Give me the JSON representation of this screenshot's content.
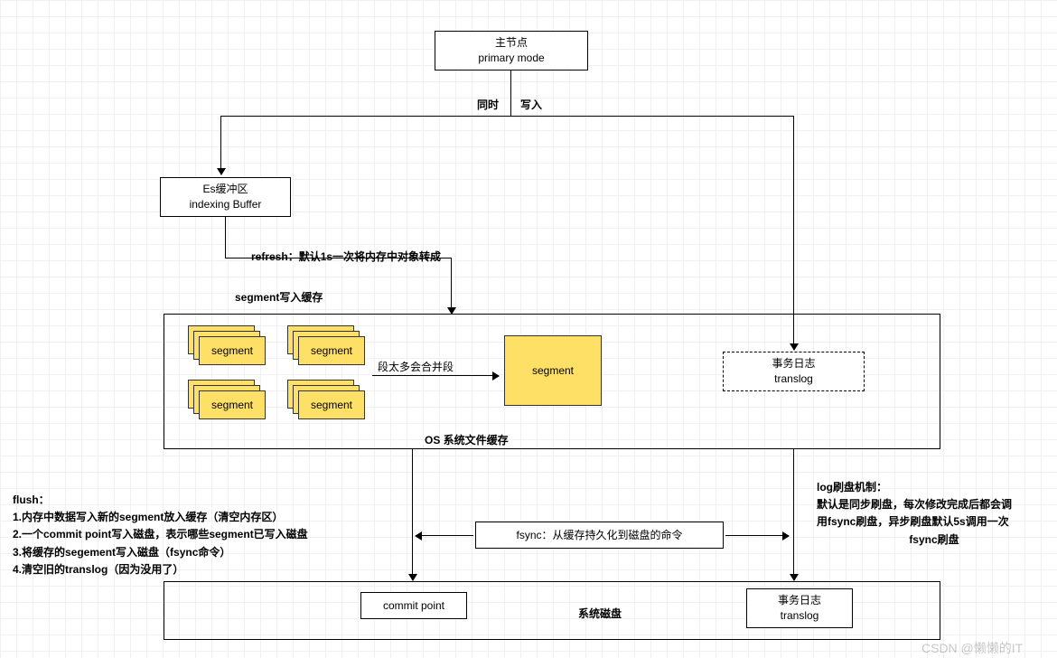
{
  "primary": {
    "line1": "主节点",
    "line2": "primary mode"
  },
  "split": {
    "left": "同时",
    "right": "写入"
  },
  "buffer": {
    "line1": "Es缓冲区",
    "line2": "indexing Buffer"
  },
  "refresh_label": "refresh：默认1s一次将内存中对象转成",
  "segment_cache_label": "segment写入缓存",
  "segment_word": "segment",
  "merge_label": "段太多会合并段",
  "os_cache_label": "OS  系统文件缓存",
  "translog": {
    "line1": "事务日志",
    "line2": "translog"
  },
  "flush": {
    "title": "flush：",
    "l1": "1.内存中数据写入新的segment放入缓存（清空内存区）",
    "l2": "2.一个commit point写入磁盘，表示哪些segment已写入磁盘",
    "l3": "3.将缓存的segement写入磁盘（fsync命令）",
    "l4": "4.清空旧的translog（因为没用了）"
  },
  "fsync_label": "fsync：从缓存持久化到磁盘的命令",
  "log_flush": {
    "title": "log刷盘机制：",
    "l1": "默认是同步刷盘，每次修改完成后都会调",
    "l2": "用fsync刷盘，异步刷盘默认5s调用一次",
    "l3": "fsync刷盘"
  },
  "commit_point": "commit point",
  "disk_label": "系统磁盘",
  "disk_translog": {
    "line1": "事务日志",
    "line2": "translog"
  },
  "watermark": "CSDN @懒懒的IT"
}
